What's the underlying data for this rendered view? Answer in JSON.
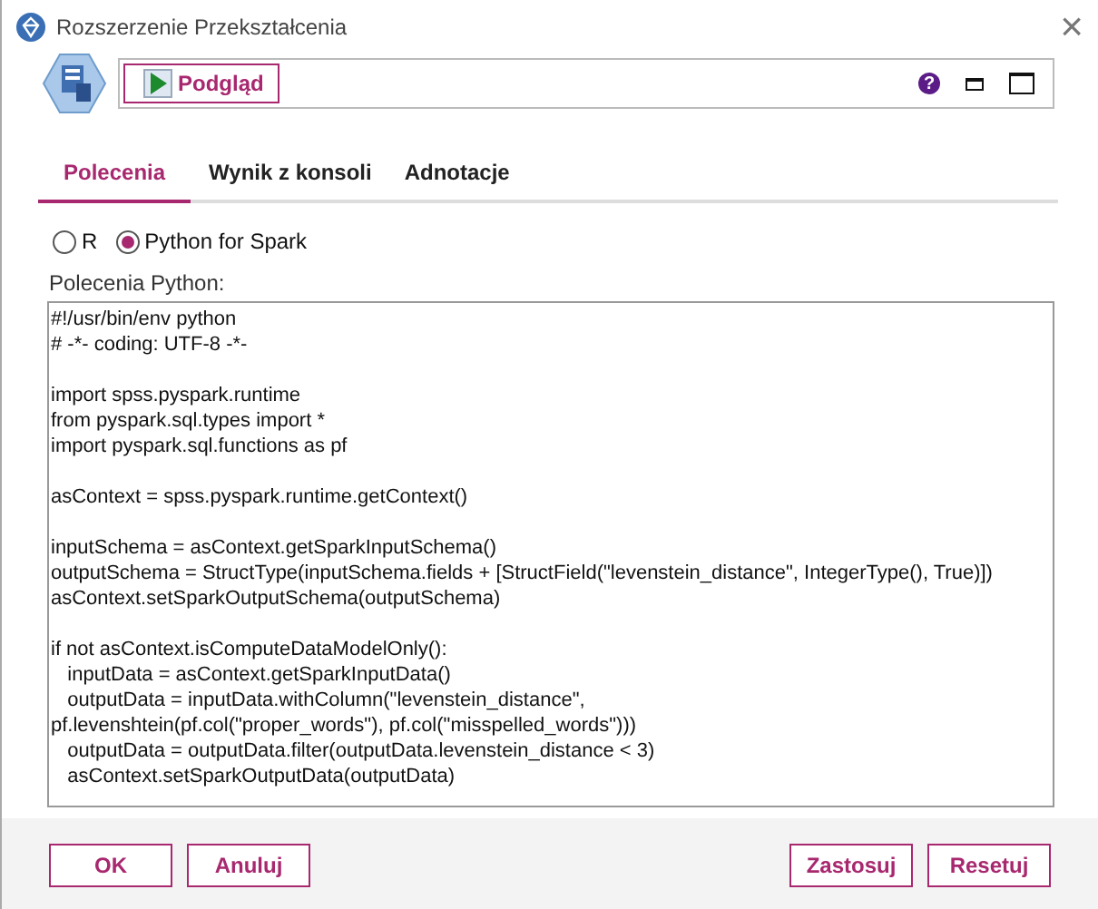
{
  "window": {
    "title": "Rozszerzenie Przekształcenia",
    "close": "×"
  },
  "toolbar": {
    "preview_button": "Podgląd",
    "help": "?"
  },
  "tabs": [
    {
      "label": "Polecenia",
      "selected": true
    },
    {
      "label": "Wynik z konsoli",
      "selected": false
    },
    {
      "label": "Adnotacje",
      "selected": false
    }
  ],
  "language": [
    {
      "label": "R",
      "selected": false
    },
    {
      "label": "Python for Spark",
      "selected": true
    }
  ],
  "editor": {
    "label": "Polecenia Python:",
    "blocks": [
      [
        "#!/usr/bin/env python",
        "# -*- coding: UTF-8 -*-"
      ],
      [
        "import spss.pyspark.runtime",
        "from pyspark.sql.types import *",
        "import pyspark.sql.functions as pf"
      ],
      [
        "asContext = spss.pyspark.runtime.getContext()"
      ],
      [
        "inputSchema = asContext.getSparkInputSchema()",
        "outputSchema = StructType(inputSchema.fields + [StructField(\"levenstein_distance\", IntegerType(), True)])",
        "asContext.setSparkOutputSchema(outputSchema)"
      ],
      [
        "if not asContext.isComputeDataModelOnly():",
        "   inputData = asContext.getSparkInputData()",
        "   outputData = inputData.withColumn(\"levenstein_distance\",",
        "pf.levenshtein(pf.col(\"proper_words\"), pf.col(\"misspelled_words\")))",
        "   outputData = outputData.filter(outputData.levenstein_distance < 3)",
        "   asContext.setSparkOutputData(outputData)"
      ]
    ]
  },
  "buttons_left": [
    "OK",
    "Anuluj"
  ],
  "buttons_right": [
    "Zastosuj",
    "Resetuj"
  ]
}
